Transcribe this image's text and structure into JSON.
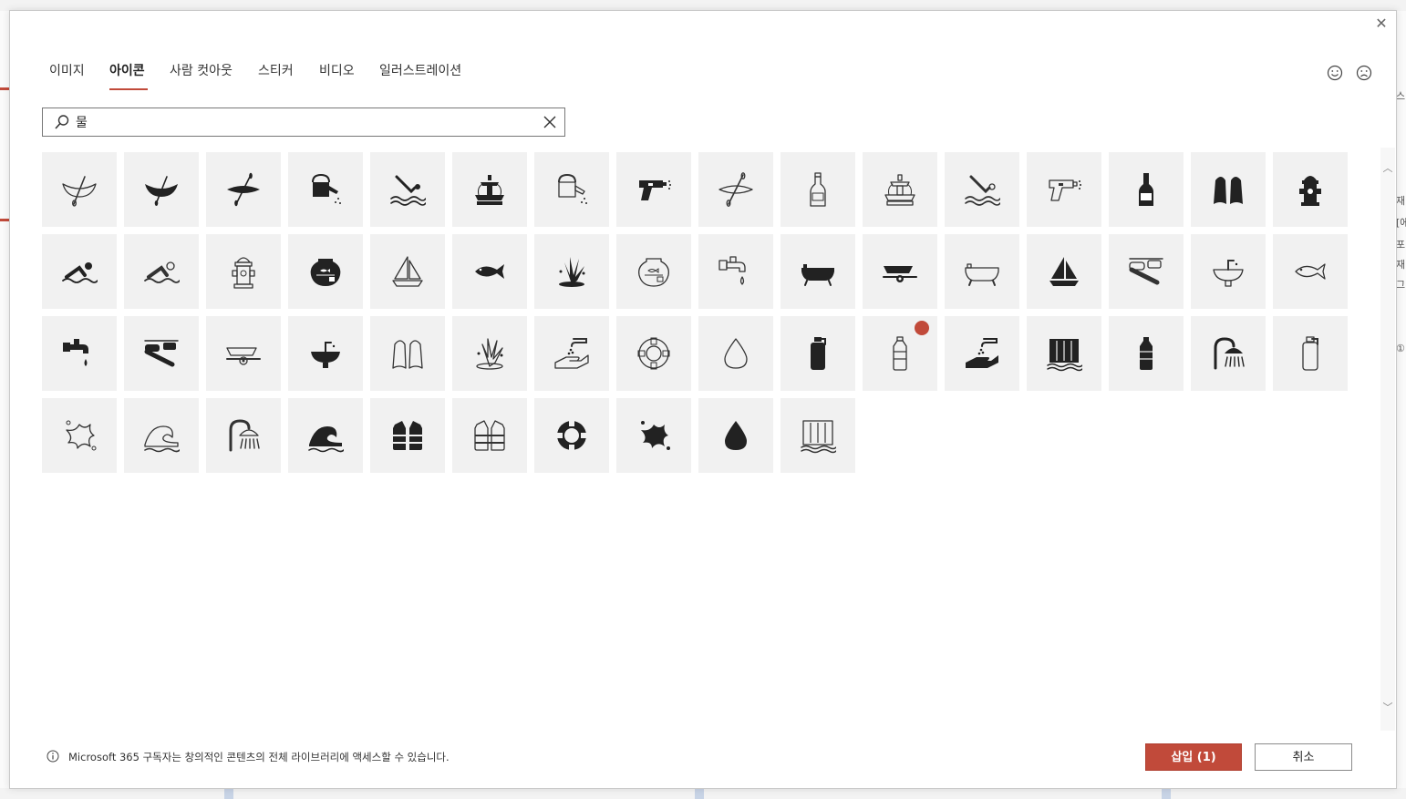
{
  "dialog": {
    "tabs": [
      {
        "label": "이미지"
      },
      {
        "label": "아이콘"
      },
      {
        "label": "사람 컷아웃"
      },
      {
        "label": "스티커"
      },
      {
        "label": "비디오"
      },
      {
        "label": "일러스트레이션"
      }
    ],
    "active_tab": "아이콘",
    "search": {
      "value": "물"
    },
    "icons": [
      "canoe-outline",
      "canoe",
      "kayak",
      "watering-can",
      "diver",
      "fountain",
      "watering-can-outline",
      "water-gun",
      "kayak-outline",
      "bottle-outline",
      "fountain-outline",
      "diver-outline",
      "water-gun-outline",
      "bottle",
      "swim-fins",
      "fire-hydrant",
      "swimmer",
      "swimmer-outline",
      "fire-hydrant-outline",
      "fish-bowl",
      "sailboat-outline",
      "fish",
      "splash",
      "fish-bowl-outline",
      "faucet-outline",
      "bathtub",
      "boat-trailer",
      "bathtub-outline",
      "sailboat",
      "snorkeler-outline",
      "sink-outline",
      "fish-outline",
      "faucet",
      "snorkeler",
      "boat-trailer-outline",
      "sink",
      "swim-fins-outline",
      "splash-outline",
      "hand-water-outline",
      "life-ring-outline",
      "water-drop-outline",
      "water-bottle",
      "plastic-bottle-outline",
      "hand-water",
      "waterfall",
      "plastic-bottle",
      "shower",
      "water-bottle-outline",
      "splatter-outline",
      "wave-outline",
      "shower-outline",
      "wave",
      "life-vest",
      "life-vest-outline",
      "life-ring",
      "splatter",
      "water-drop",
      "waterfall-outline"
    ],
    "selected_icon": "plastic-bottle-outline",
    "footer_info": "Microsoft 365 구독자는 창의적인 콘텐츠의 전체 라이브러리에 액세스할 수 있습니다.",
    "insert_label": "삽입 (1)",
    "cancel_label": "취소",
    "accent_color": "#c14a3a"
  },
  "background": {
    "right_fragments": [
      "스",
      "재",
      "[에",
      "포",
      "재",
      "그",
      "①"
    ]
  }
}
